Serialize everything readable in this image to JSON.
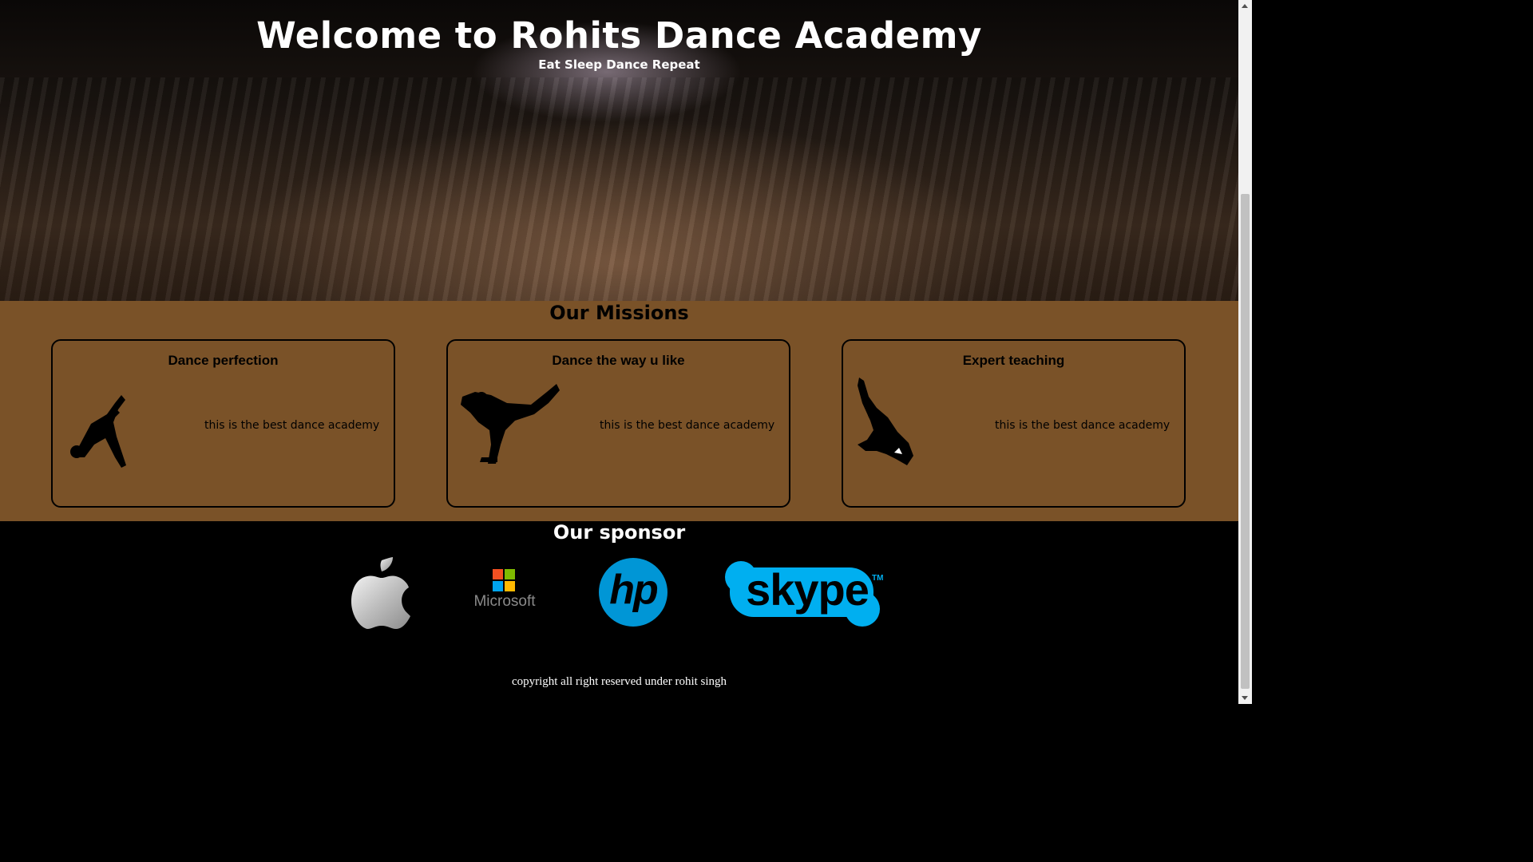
{
  "hero": {
    "title": "Welcome to Rohits Dance Academy",
    "tagline": "Eat Sleep Dance Repeat"
  },
  "missions": {
    "heading": "Our Missions",
    "cards": [
      {
        "title": "Dance perfection",
        "text": "this is the best dance academy",
        "icon": "dancer-silhouette-icon"
      },
      {
        "title": "Dance the way u like",
        "text": "this is the best dance academy",
        "icon": "breakdancer-silhouette-icon"
      },
      {
        "title": "Expert teaching",
        "text": "this is the best dance academy",
        "icon": "dancer-jump-silhouette-icon"
      }
    ]
  },
  "sponsors": {
    "heading": "Our sponsor",
    "logos": [
      "apple-logo",
      "microsoft-logo",
      "hp-logo",
      "skype-logo"
    ],
    "microsoft_text": "Microsoft",
    "hp_text": "hp",
    "skype_text": "skype",
    "skype_tm": "TM"
  },
  "footer": {
    "copyright": "copyright all right reserved under rohit singh"
  },
  "colors": {
    "missions_bg": "#7a5228",
    "page_bg": "#000000",
    "hp_blue": "#0096d6",
    "skype_blue": "#00aff0"
  }
}
